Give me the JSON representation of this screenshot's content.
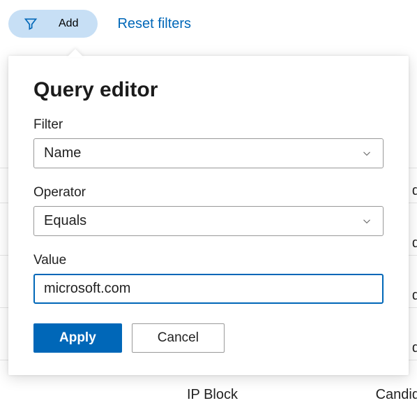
{
  "topbar": {
    "add_label": "Add",
    "reset_label": "Reset filters"
  },
  "panel": {
    "title": "Query editor",
    "filter_label": "Filter",
    "filter_value": "Name",
    "operator_label": "Operator",
    "operator_value": "Equals",
    "value_label": "Value",
    "value_input": "microsoft.com",
    "apply_label": "Apply",
    "cancel_label": "Cancel"
  },
  "background": {
    "ip_block": "IP Block",
    "candid": "Candid",
    "right_d": "d"
  }
}
